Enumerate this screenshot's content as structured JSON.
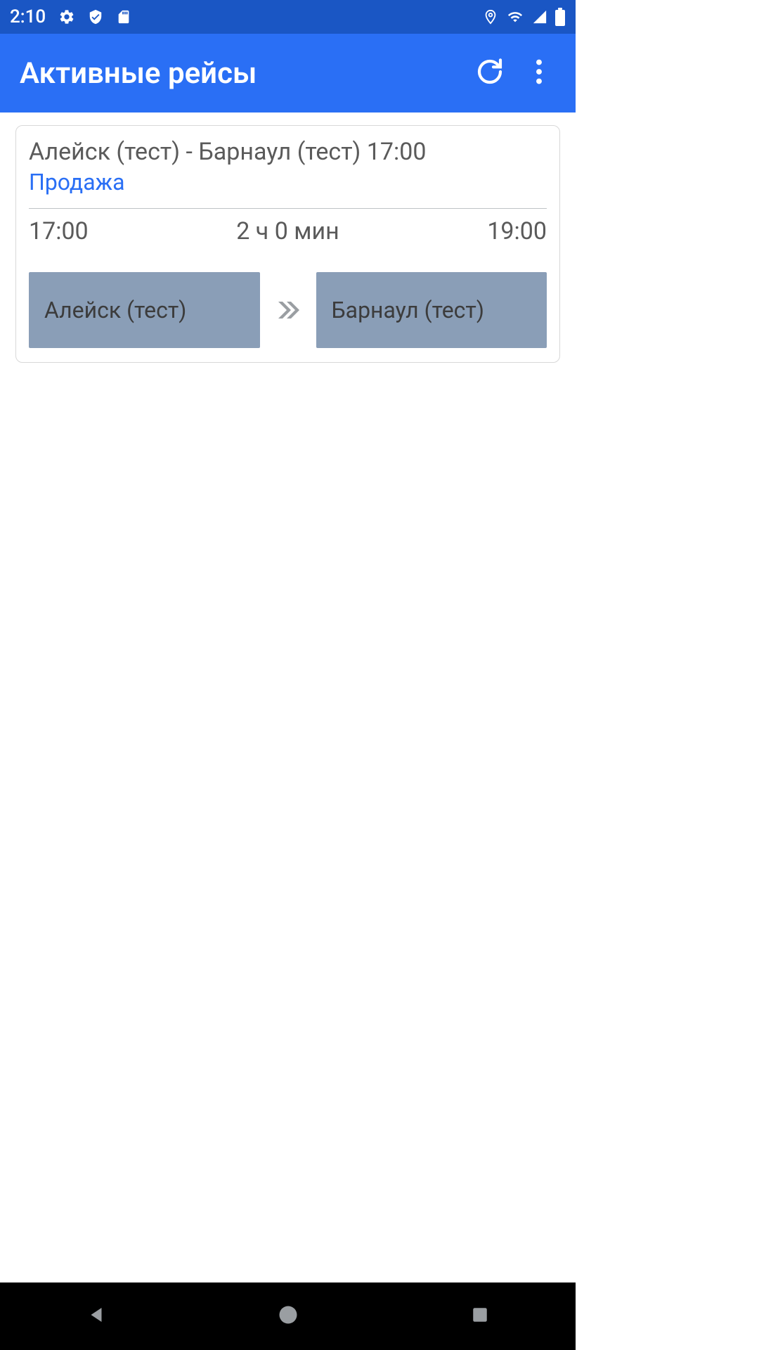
{
  "status_bar": {
    "time": "2:10"
  },
  "app_bar": {
    "title": "Активные рейсы"
  },
  "card": {
    "route_title": "Алейск (тест) - Барнаул (тест) 17:00",
    "status": "Продажа",
    "depart_time": "17:00",
    "duration": "2 ч 0 мин",
    "arrive_time": "19:00",
    "station_from": "Алейск (тест)",
    "station_to": "Барнаул (тест)"
  }
}
